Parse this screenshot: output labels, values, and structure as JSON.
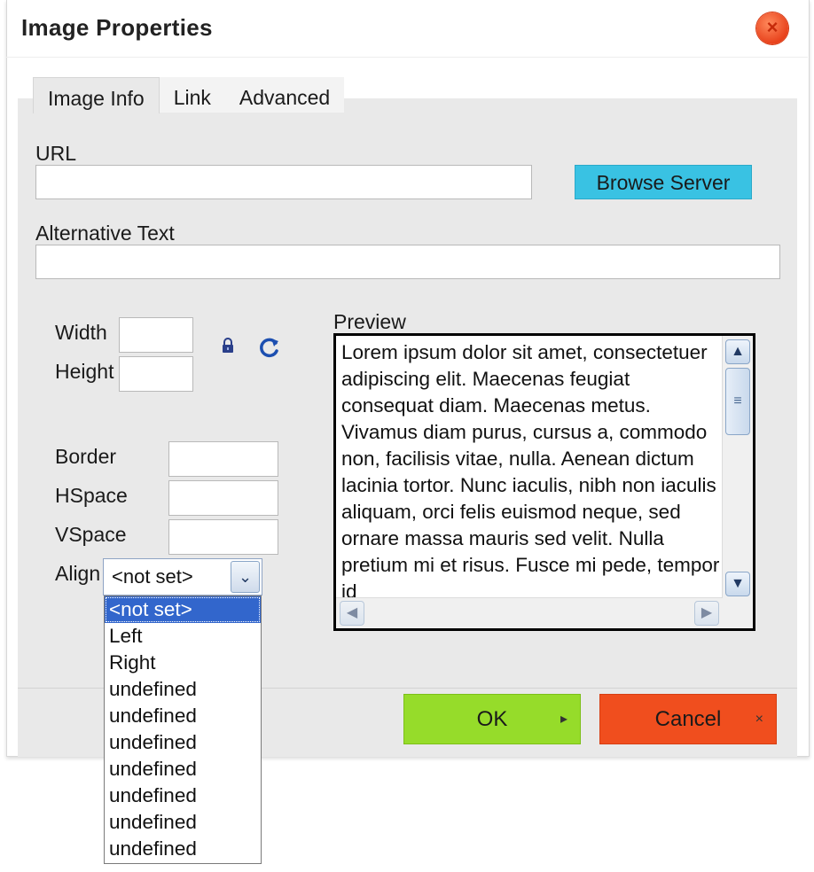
{
  "dialog": {
    "title": "Image Properties",
    "close_glyph": "×"
  },
  "tabs": [
    {
      "label": "Image Info",
      "active": true
    },
    {
      "label": "Link",
      "active": false
    },
    {
      "label": "Advanced",
      "active": false
    }
  ],
  "form": {
    "url_label": "URL",
    "url_value": "",
    "browse_label": "Browse Server",
    "alt_label": "Alternative Text",
    "alt_value": "",
    "width_label": "Width",
    "height_label": "Height",
    "border_label": "Border",
    "hspace_label": "HSpace",
    "vspace_label": "VSpace",
    "align_label": "Align",
    "align_value": "<not set>"
  },
  "align_options": [
    "<not set>",
    "Left",
    "Right",
    "undefined",
    "undefined",
    "undefined",
    "undefined",
    "undefined",
    "undefined",
    "undefined"
  ],
  "preview": {
    "label": "Preview",
    "text": "Lorem ipsum dolor sit amet, consectetuer adipiscing elit. Maecenas feugiat consequat diam. Maecenas metus. Vivamus diam purus, cursus a, commodo non, facilisis vitae, nulla. Aenean dictum lacinia tortor. Nunc iaculis, nibh non iaculis aliquam, orci felis euismod neque, sed ornare massa mauris sed velit. Nulla pretium mi et risus. Fusce mi pede, tempor id"
  },
  "buttons": {
    "ok": "OK",
    "cancel": "Cancel",
    "ok_glyph": "▸",
    "cancel_glyph": "×"
  },
  "icons": {
    "lock": "lock-icon",
    "refresh": "refresh-icon",
    "close": "close-icon",
    "scroll_up": "▲",
    "scroll_down": "▼",
    "scroll_left": "◀",
    "scroll_right": "▶",
    "grip": "≡",
    "dropdown_arrow": "⌄"
  },
  "colors": {
    "browse": "#39c2e3",
    "ok": "#96dc2a",
    "cancel": "#f04e1e",
    "selected": "#3266cc"
  }
}
